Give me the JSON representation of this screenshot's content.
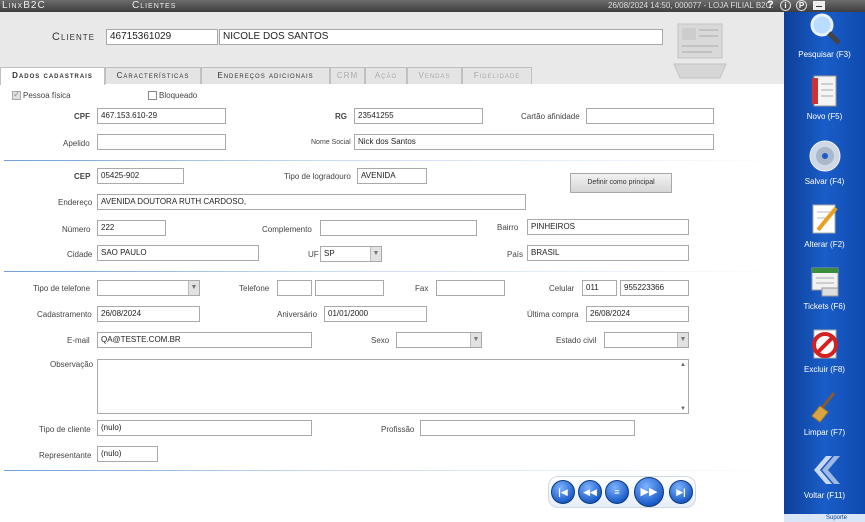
{
  "titlebar": {
    "app_name": "LinxB2C",
    "window_title": "Clientes",
    "status": "26/08/2024 14:50, 000077 - LOJA FILIAL B2C."
  },
  "cliente": {
    "label": "Cliente",
    "code": "46715361029",
    "name": "NICOLE DOS SANTOS"
  },
  "tabs": [
    {
      "label": "Dados cadastrais",
      "active": true
    },
    {
      "label": "Características"
    },
    {
      "label": "Endereços adicionais"
    },
    {
      "label": "CRM",
      "disabled": true
    },
    {
      "label": "Ação",
      "disabled": true
    },
    {
      "label": "Vendas",
      "disabled": true
    },
    {
      "label": "Fidelidade",
      "disabled": true
    }
  ],
  "form": {
    "pessoa_fisica": "Pessoa física",
    "bloqueado": "Bloqueado",
    "cpf_label": "CPF",
    "cpf": "467.153.610-29",
    "rg_label": "RG",
    "rg": "23541255",
    "cartao_label": "Cartão afinidade",
    "cartao": "",
    "apelido_label": "Apelido",
    "apelido": "",
    "nome_social_label": "Nome Social",
    "nome_social": "Nick dos Santos",
    "cep_label": "CEP",
    "cep": "05425-902",
    "tipo_logradouro_label": "Tipo de logradouro",
    "tipo_logradouro": "AVENIDA",
    "definir_principal": "Definir como principal",
    "endereco_label": "Endereço",
    "endereco": "AVENIDA DOUTORA RUTH CARDOSO,",
    "numero_label": "Número",
    "numero": "222",
    "complemento_label": "Complemento",
    "complemento": "",
    "bairro_label": "Bairro",
    "bairro": "PINHEIROS",
    "cidade_label": "Cidade",
    "cidade": "SAO PAULO",
    "uf_label": "UF",
    "uf": "SP",
    "pais_label": "País",
    "pais": "BRASIL",
    "tipo_telefone_label": "Tipo de telefone",
    "tipo_telefone": "",
    "telefone_label": "Telefone",
    "telefone_ddd": "",
    "telefone": "",
    "fax_label": "Fax",
    "fax": "",
    "celular_label": "Celular",
    "celular_ddd": "011",
    "celular": "955223366",
    "cadastramento_label": "Cadastramento",
    "cadastramento": "26/08/2024",
    "aniversario_label": "Aniversário",
    "aniversario": "01/01/2000",
    "ultima_compra_label": "Última compra",
    "ultima_compra": "26/08/2024",
    "email_label": "E-mail",
    "email": "QA@TESTE.COM.BR",
    "sexo_label": "Sexo",
    "sexo": "",
    "estado_civil_label": "Estado civil",
    "estado_civil": "",
    "observacao_label": "Observação",
    "observacao": "",
    "tipo_cliente_label": "Tipo de cliente",
    "tipo_cliente": "(nulo)",
    "profissao_label": "Profissão",
    "profissao": "",
    "representante_label": "Representante",
    "representante": "(nulo)"
  },
  "sidebar": [
    {
      "label": "Pesquisar (F3)",
      "icon": "magnifier-icon"
    },
    {
      "label": "Novo (F5)",
      "icon": "new-document-icon"
    },
    {
      "label": "Salvar (F4)",
      "icon": "disk-icon"
    },
    {
      "label": "Alterar (F2)",
      "icon": "edit-pencil-icon"
    },
    {
      "label": "Tickets (F6)",
      "icon": "tickets-icon"
    },
    {
      "label": "Excluir (F8)",
      "icon": "delete-icon"
    },
    {
      "label": "Limpar (F7)",
      "icon": "broom-icon"
    },
    {
      "label": "Voltar (F11)",
      "icon": "back-arrow-icon"
    }
  ],
  "suporte": "Suporte"
}
